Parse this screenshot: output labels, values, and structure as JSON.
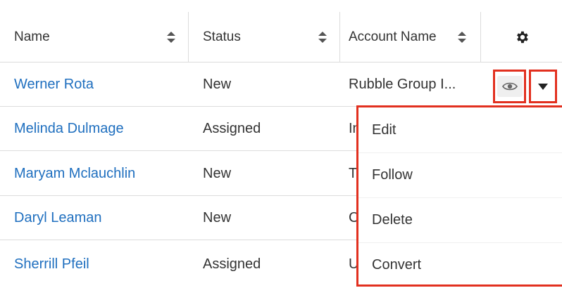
{
  "table": {
    "columns": [
      {
        "label": "Name"
      },
      {
        "label": "Status"
      },
      {
        "label": "Account Name"
      }
    ],
    "rows": [
      {
        "name": "Werner Rota",
        "status": "New",
        "account": "Rubble Group I..."
      },
      {
        "name": "Melinda Dulmage",
        "status": "Assigned",
        "account": "In"
      },
      {
        "name": "Maryam Mclauchlin",
        "status": "New",
        "account": "T"
      },
      {
        "name": "Daryl Leaman",
        "status": "New",
        "account": "C"
      },
      {
        "name": "Sherrill Pfeil",
        "status": "Assigned",
        "account": "U"
      }
    ]
  },
  "icons": {
    "settings": "gear-icon",
    "sort": "sort-icon",
    "preview": "eye-icon",
    "actions": "caret-down-icon"
  },
  "action_menu": {
    "items": [
      "Edit",
      "Follow",
      "Delete",
      "Convert"
    ]
  },
  "colors": {
    "link": "#1f6fbf",
    "highlight": "#e2301f",
    "border": "#dcdcdc"
  }
}
